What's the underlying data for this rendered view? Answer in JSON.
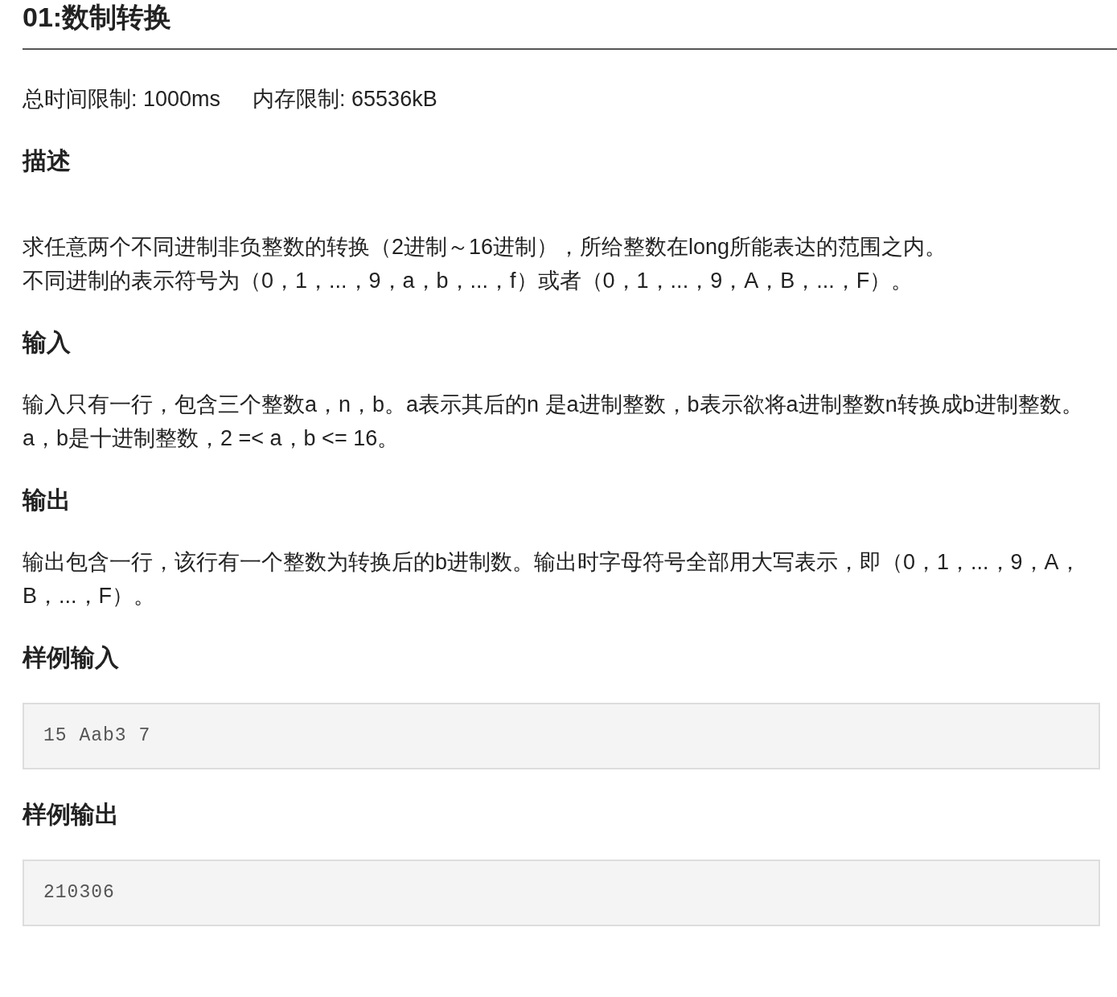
{
  "title": "01:数制转换",
  "limits": [
    "总时间限制: 1000ms",
    "内存限制: 65536kB"
  ],
  "sections": [
    {
      "heading": "描述",
      "kind": "text",
      "lines": [
        "求任意两个不同进制非负整数的转换（2进制～16进制），所给整数在long所能表达的范围之内。",
        "不同进制的表示符号为（0，1，...，9，a，b，...，f）或者（0，1，...，9，A，B，...，F）。"
      ]
    },
    {
      "heading": "输入",
      "kind": "text",
      "lines": [
        "输入只有一行，包含三个整数a，n，b。a表示其后的n 是a进制整数，b表示欲将a进制整数n转换成b进制整数。",
        "a，b是十进制整数，2 =< a，b <= 16。"
      ]
    },
    {
      "heading": "输出",
      "kind": "text",
      "lines": [
        "输出包含一行，该行有一个整数为转换后的b进制数。输出时字母符号全部用大写表示，即（0，1，...，9，A，B，...，F）。"
      ]
    },
    {
      "heading": "样例输入",
      "kind": "code",
      "lines": [
        "15 Aab3 7"
      ]
    },
    {
      "heading": "样例输出",
      "kind": "code",
      "lines": [
        "210306"
      ]
    }
  ]
}
